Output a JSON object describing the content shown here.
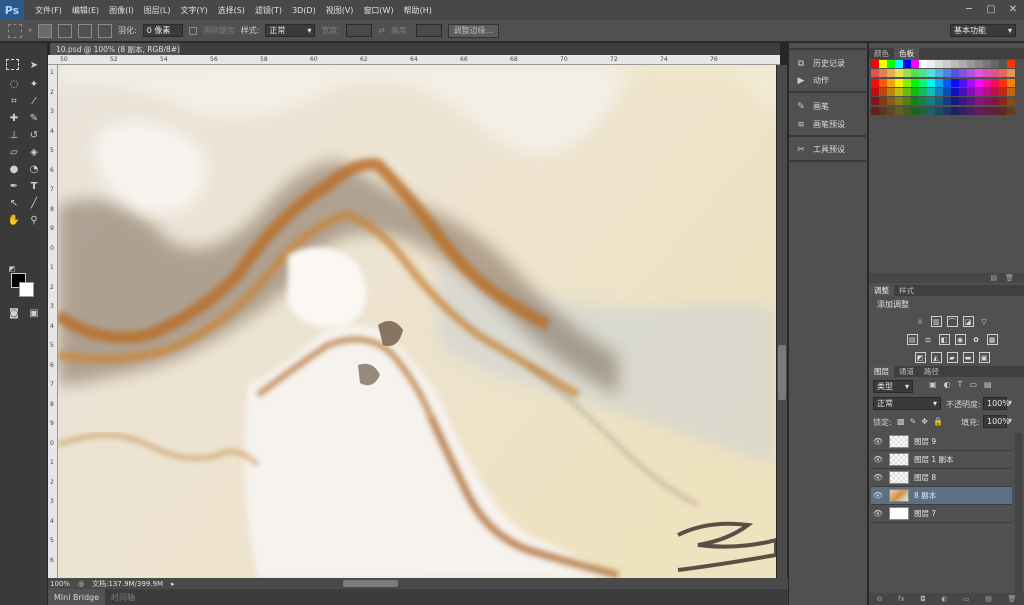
{
  "app": {
    "logo": "Ps"
  },
  "menu": [
    "文件(F)",
    "编辑(E)",
    "图像(I)",
    "图层(L)",
    "文字(Y)",
    "选择(S)",
    "滤镜(T)",
    "3D(D)",
    "视图(V)",
    "窗口(W)",
    "帮助(H)"
  ],
  "window_controls": [
    "─",
    "▢",
    "✕"
  ],
  "options": {
    "feather_label": "羽化:",
    "feather_value": "0 像素",
    "antialias_label": "消除锯齿",
    "style_label": "样式:",
    "style_value": "正常",
    "width_label": "宽度:",
    "height_label": "高度:",
    "refine_edge": "调整边缘...",
    "workspace": "基本功能"
  },
  "document": {
    "tab_title": "10.psd @ 100% (8 副本, RGB/8#)",
    "close": "×",
    "zoom": "100%",
    "doc_size": "文档:137.9M/399.9M"
  },
  "ruler": {
    "h_ticks": [
      "50",
      "52",
      "54",
      "56",
      "58",
      "60",
      "62",
      "64",
      "66",
      "68",
      "70",
      "72",
      "74",
      "76"
    ],
    "v_ticks": [
      "1",
      "2",
      "3",
      "4",
      "5",
      "6",
      "7",
      "8",
      "9",
      "0",
      "1",
      "2",
      "3",
      "4",
      "5",
      "6",
      "7",
      "8",
      "9",
      "0",
      "1",
      "2",
      "3",
      "4",
      "5",
      "6"
    ]
  },
  "bottom_tabs": [
    "Mini Bridge",
    "时间轴"
  ],
  "mid_panel": {
    "items": [
      {
        "icon": "history-icon",
        "glyph": "⧉",
        "label": "历史记录"
      },
      {
        "icon": "actions-icon",
        "glyph": "▶",
        "label": "动作"
      },
      {
        "icon": "brush-icon",
        "glyph": "✎",
        "label": "画笔"
      },
      {
        "icon": "brush-presets-icon",
        "glyph": "≡",
        "label": "画笔预设"
      },
      {
        "icon": "tool-presets-icon",
        "glyph": "✂",
        "label": "工具预设"
      }
    ]
  },
  "color_panel": {
    "tabs": [
      "颜色",
      "色板"
    ],
    "active": 1
  },
  "adjust_panel": {
    "tabs": [
      "调整",
      "样式"
    ],
    "title": "添加调整"
  },
  "layers_panel": {
    "tabs": [
      "图层",
      "通道",
      "路径"
    ],
    "filter_label": "类型",
    "blend_mode": "正常",
    "opacity_label": "不透明度:",
    "opacity_value": "100%",
    "lock_label": "锁定:",
    "fill_label": "填充:",
    "fill_value": "100%",
    "layers": [
      {
        "name": "图层 9",
        "thumb": "transparent",
        "selected": false
      },
      {
        "name": "图层 1 副本",
        "thumb": "transparent",
        "selected": false
      },
      {
        "name": "图层 8",
        "thumb": "transparent",
        "selected": false
      },
      {
        "name": "8 副本",
        "thumb": "texture",
        "selected": true
      },
      {
        "name": "图层 7",
        "thumb": "white",
        "selected": false
      }
    ],
    "footer_icons": [
      "⊝",
      "fx",
      "◘",
      "◐",
      "▭",
      "▤",
      "🗑"
    ]
  },
  "colors": {
    "swatch_rows": 6
  }
}
